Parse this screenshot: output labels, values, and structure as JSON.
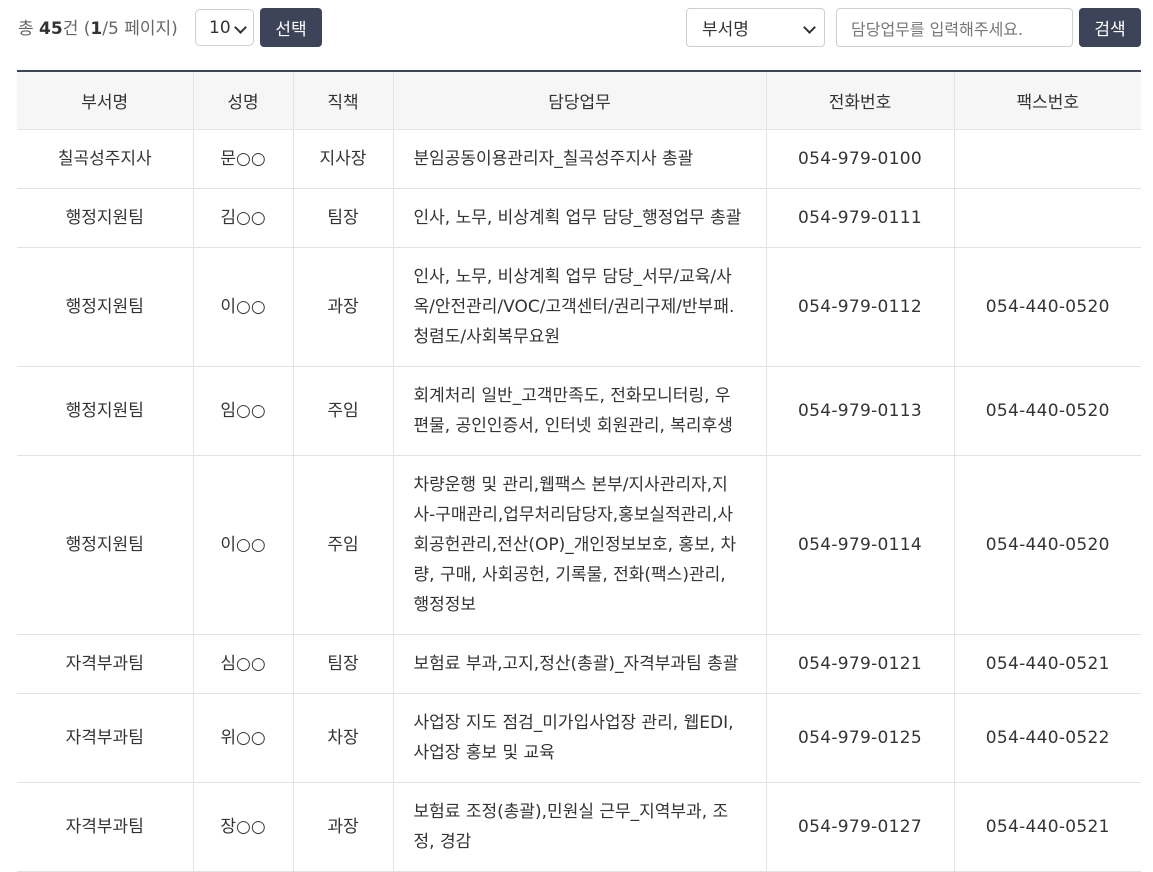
{
  "toolbar": {
    "total_prefix": "총 ",
    "total_count": "45",
    "total_suffix": "건 (",
    "current_page": "1",
    "total_pages": "/5 페이지)",
    "page_size": "10",
    "select_button": "선택",
    "search_field_select": "부서명",
    "search_placeholder": "담당업무를 입력해주세요.",
    "search_button": "검색"
  },
  "table": {
    "headers": [
      "부서명",
      "성명",
      "직책",
      "담당업무",
      "전화번호",
      "팩스번호"
    ],
    "rows": [
      [
        "칠곡성주지사",
        "문○○",
        "지사장",
        "분임공동이용관리자_칠곡성주지사 총괄",
        "054-979-0100",
        ""
      ],
      [
        "행정지원팀",
        "김○○",
        "팀장",
        "인사, 노무, 비상계획 업무 담당_행정업무 총괄",
        "054-979-0111",
        ""
      ],
      [
        "행정지원팀",
        "이○○",
        "과장",
        "인사, 노무, 비상계획 업무 담당_서무/교육/사옥/안전관리/VOC/고객센터/권리구제/반부패.청렴도/사회복무요원",
        "054-979-0112",
        "054-440-0520"
      ],
      [
        "행정지원팀",
        "임○○",
        "주임",
        "회계처리 일반_고객만족도, 전화모니터링, 우편물, 공인인증서, 인터넷 회원관리, 복리후생",
        "054-979-0113",
        "054-440-0520"
      ],
      [
        "행정지원팀",
        "이○○",
        "주임",
        "차량운행 및 관리,웹팩스 본부/지사관리자,지사-구매관리,업무처리담당자,홍보실적관리,사회공헌관리,전산(OP)_개인정보보호, 홍보, 차량, 구매, 사회공헌, 기록물, 전화(팩스)관리, 행정정보",
        "054-979-0114",
        "054-440-0520"
      ],
      [
        "자격부과팀",
        "심○○",
        "팀장",
        "보험료 부과,고지,정산(총괄)_자격부과팀 총괄",
        "054-979-0121",
        "054-440-0521"
      ],
      [
        "자격부과팀",
        "위○○",
        "차장",
        "사업장 지도 점검_미가입사업장 관리, 웹EDI, 사업장 홍보 및 교육",
        "054-979-0125",
        "054-440-0522"
      ],
      [
        "자격부과팀",
        "장○○",
        "과장",
        "보험료 조정(총괄),민원실 근무_지역부과, 조정, 경감",
        "054-979-0127",
        "054-440-0521"
      ]
    ]
  }
}
